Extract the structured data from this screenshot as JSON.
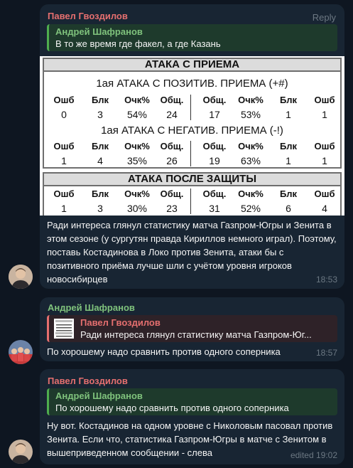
{
  "messages": [
    {
      "sender": "Павел Гвоздилов",
      "reply_label": "Reply",
      "quote": {
        "name": "Андрей Шафранов",
        "text": "В то же время где факел, а где Казань"
      },
      "text": "Ради интереса глянул статистику матча Газпром-Югры и Зенита в этом сезоне (у сургутян правда Кириллов немного играл). Поэтому, поставь Костадинова в Локо против Зенита, атаки бы с позитивного приёма лучше шли с учётом уровня игроков новосибирцев",
      "time": "18:53"
    },
    {
      "sender": "Андрей Шафранов",
      "quote": {
        "name": "Павел Гвоздилов",
        "text": "Ради интереса глянул статистику матча Газпром-Юг..."
      },
      "text": "По хорошему надо сравнить против одного соперника",
      "time": "18:57"
    },
    {
      "sender": "Павел Гвоздилов",
      "quote": {
        "name": "Андрей Шафранов",
        "text": "По хорошему надо сравнить против одного соперника"
      },
      "text": "Ну вот. Костадинов на одном уровне с Николовым пасовал против Зенита. Если что, статистика Газпром-Югры в матче с Зенитом в вышеприведенном сообщении - слева",
      "time": "edited 19:02"
    }
  ],
  "stats": {
    "section1_title": "АТАКА С ПРИЕМА",
    "sub1": "1ая АТАКА С ПОЗИТИВ. ПРИЕМА (+#)",
    "sub2": "1ая АТАКА С НЕГАТИВ. ПРИЕМА (-!)",
    "section2_title": "АТАКА ПОСЛЕ ЗАЩИТЫ",
    "headers": [
      "Ошб",
      "Блк",
      "Очк%",
      "Общ.",
      "Общ.",
      "Очк%",
      "Блк",
      "Ошб"
    ],
    "row1": [
      "0",
      "3",
      "54%",
      "24",
      "17",
      "53%",
      "1",
      "1"
    ],
    "row2": [
      "1",
      "4",
      "35%",
      "26",
      "19",
      "63%",
      "1",
      "1"
    ],
    "row3": [
      "1",
      "3",
      "30%",
      "23",
      "31",
      "52%",
      "6",
      "4"
    ]
  },
  "colors": {
    "background": "#0e1621",
    "bubble": "#182533",
    "red_name": "#e56f6f",
    "green_name": "#7fc27c"
  }
}
